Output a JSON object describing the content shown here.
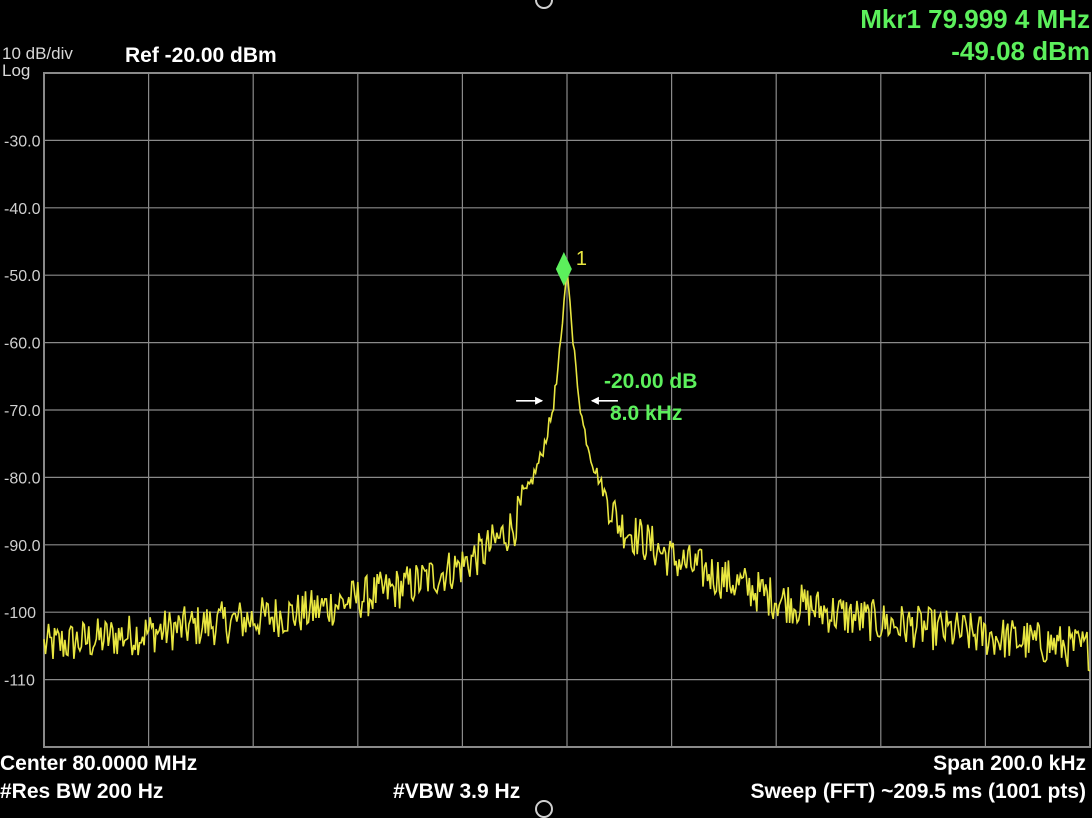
{
  "header": {
    "scale_div": "10 dB/div",
    "scale_type": "Log",
    "ref_level": "Ref -20.00 dBm",
    "marker_freq": "Mkr1 79.999 4 MHz",
    "marker_amp": "-49.08 dBm"
  },
  "footer": {
    "center": "Center 80.0000 MHz",
    "span": "Span 200.0 kHz",
    "rbw": "#Res BW 200 Hz",
    "vbw": "#VBW 3.9 Hz",
    "sweep": "Sweep (FFT)  ~209.5 ms (1001 pts)"
  },
  "colors": {
    "background": "#000000",
    "grid": "#8a8a8a",
    "trace": "#e8e640",
    "marker": "#5cf05c",
    "annotation": "#5cf05c"
  },
  "chart_data": {
    "type": "line",
    "title": "",
    "xlabel": "",
    "ylabel": "",
    "x_unit": "kHz offset from 80.0000 MHz",
    "xlim": [
      -100,
      100
    ],
    "ylim": [
      -120,
      -20
    ],
    "y_ticks": [
      -30,
      -40,
      -50,
      -60,
      -70,
      -80,
      -90,
      -100,
      -110
    ],
    "y_tick_labels": [
      "-30.0",
      "-40.0",
      "-50.0",
      "-60.0",
      "-70.0",
      "-80.0",
      "-90.0",
      "-100",
      "-110"
    ],
    "grid": true,
    "grid_divisions": {
      "x": 10,
      "y": 10
    },
    "series": [
      {
        "x": [
          -100,
          -90,
          -80,
          -70,
          -60,
          -50,
          -40,
          -30,
          -20,
          -15,
          -10,
          -7,
          -5,
          -3,
          -2,
          -1,
          -0.6,
          0,
          0.6,
          1,
          2,
          3,
          5,
          7,
          10,
          15,
          20,
          30,
          40,
          50,
          60,
          70,
          80,
          90,
          100
        ],
        "y": [
          -105,
          -104,
          -103,
          -102,
          -101,
          -100,
          -98,
          -96,
          -93,
          -90.5,
          -87,
          -81,
          -77,
          -71,
          -66,
          -59,
          -54,
          -49.08,
          -54,
          -59,
          -66,
          -72,
          -78,
          -82,
          -87,
          -89.5,
          -92,
          -95,
          -98,
          -100,
          -101.5,
          -102.5,
          -103.5,
          -104.5,
          -105.5
        ]
      }
    ],
    "marker": {
      "label": "1",
      "x": -0.6,
      "y": -49.08
    },
    "bandwidth_annotation": {
      "level_text": "-20.00 dB",
      "width_text": "8.0 kHz",
      "level_db": -69.08,
      "left_x": -4.0,
      "right_x": 4.0
    }
  }
}
